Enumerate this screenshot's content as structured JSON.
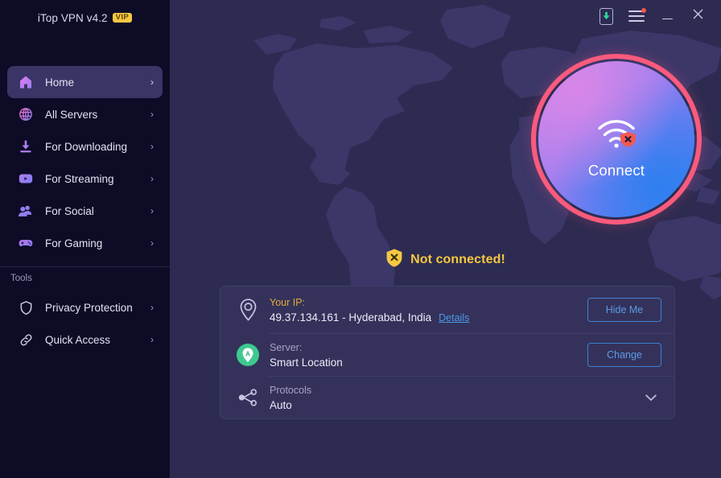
{
  "window": {
    "title": "iTop VPN v4.2",
    "vip_badge": "VIP",
    "controls": {
      "download": "download-update",
      "menu": "menu",
      "minimize": "minimize",
      "close": "close"
    }
  },
  "sidebar": {
    "items": [
      {
        "label": "Home",
        "icon": "home-icon",
        "active": true
      },
      {
        "label": "All Servers",
        "icon": "globe-icon",
        "active": false
      },
      {
        "label": "For Downloading",
        "icon": "download-icon",
        "active": false
      },
      {
        "label": "For Streaming",
        "icon": "play-icon",
        "active": false
      },
      {
        "label": "For Social",
        "icon": "people-icon",
        "active": false
      },
      {
        "label": "For Gaming",
        "icon": "gamepad-icon",
        "active": false
      }
    ],
    "tools_label": "Tools",
    "tools": [
      {
        "label": "Privacy Protection",
        "icon": "shield-icon"
      },
      {
        "label": "Quick Access",
        "icon": "link-icon"
      }
    ],
    "chevron": "›"
  },
  "main": {
    "connect_button": {
      "label": "Connect",
      "icon": "wifi-disconnected-icon",
      "ring_color": "#fb5a7d"
    },
    "status": {
      "text": "Not connected!",
      "icon": "shield-x-icon",
      "color": "#f5c842"
    },
    "card": {
      "ip_row": {
        "icon": "location-pin-icon",
        "key": "Your IP:",
        "value": "49.37.134.161 - Hyderabad, India",
        "link": "Details",
        "button": "Hide Me"
      },
      "server_row": {
        "icon": "smart-location-icon",
        "key": "Server:",
        "value": "Smart Location",
        "button": "Change"
      },
      "protocol_row": {
        "icon": "protocol-share-icon",
        "key": "Protocols",
        "value": "Auto",
        "expander": "⌄"
      }
    }
  },
  "theme": {
    "sidebar_bg": "#0d0b26",
    "main_bg": "#2d2b51",
    "card_bg": "#34325b",
    "accent_pink": "#fb5a7d",
    "accent_gold": "#f5c842",
    "accent_blue": "#4f97e8",
    "accent_green": "#3ec98f",
    "icon_purple": "#9a86ee"
  }
}
